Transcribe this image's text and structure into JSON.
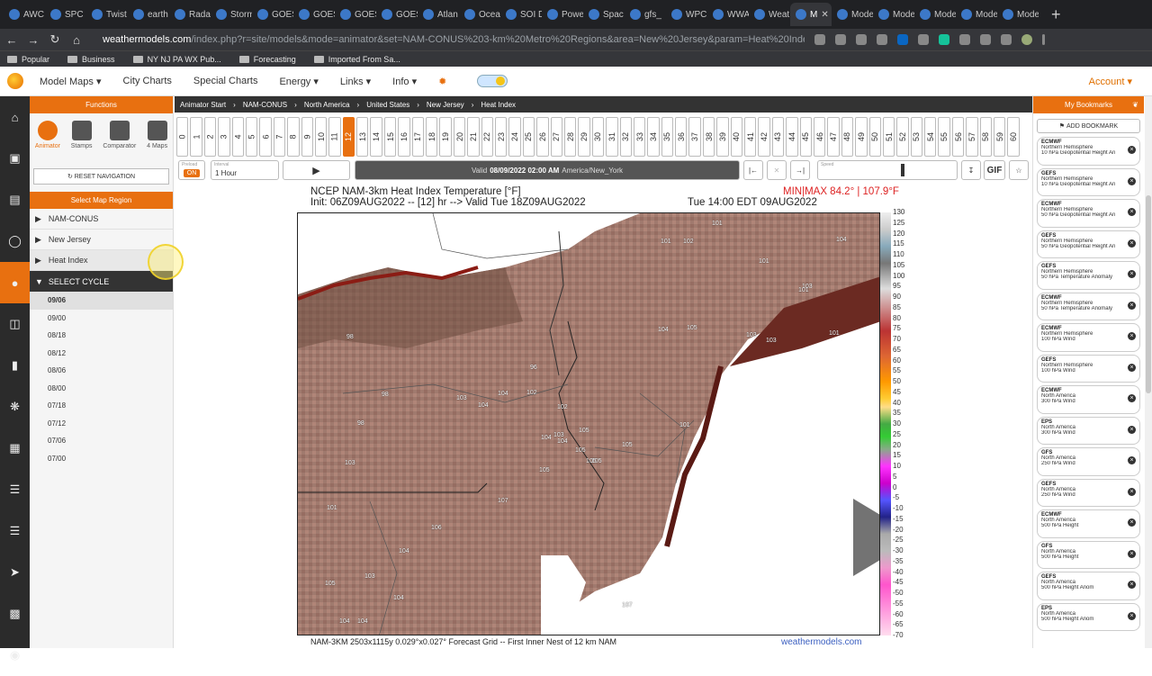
{
  "browser": {
    "tabs": [
      "AWC",
      "SPC",
      "Twist",
      "earth",
      "Rada",
      "Storm",
      "GOES",
      "GOES",
      "GOES",
      "GOES",
      "Atlan",
      "Ocea",
      "SOI D",
      "Powe",
      "Spac",
      "gfs_",
      "WPC",
      "WWA",
      "Weat",
      "M",
      "Mode",
      "Mode",
      "Mode",
      "Mode",
      "Mode"
    ],
    "active_tab_index": 19,
    "url_host": "weathermodels.com",
    "url_path": "/index.php?r=site/models&mode=animator&set=NAM-CONUS%203-km%20Metro%20Regions&area=New%20Jersey&param=Heat%20Index&offset=0",
    "bookmarks": [
      "Popular",
      "Business",
      "NY NJ PA WX Pub...",
      "Forecasting",
      "Imported From Sa..."
    ]
  },
  "site_nav": {
    "items": [
      "Model Maps",
      "City Charts",
      "Special Charts",
      "Energy",
      "Links",
      "Info"
    ],
    "account": "Account"
  },
  "functions": {
    "header": "Functions",
    "buttons": [
      "Animator",
      "Stamps",
      "Comparator",
      "4 Maps"
    ],
    "reset": "RESET NAVIGATION",
    "region_header": "Select Map Region",
    "regions": [
      "NAM-CONUS",
      "New Jersey",
      "Heat Index"
    ],
    "cycle_header": "SELECT CYCLE",
    "cycles": [
      "09/06",
      "09/00",
      "08/18",
      "08/12",
      "08/06",
      "08/00",
      "07/18",
      "07/12",
      "07/06",
      "07/00"
    ]
  },
  "breadcrumb": [
    "Animator Start",
    "NAM-CONUS",
    "North America",
    "United States",
    "New Jersey",
    "Heat Index"
  ],
  "hours": [
    "0",
    "1",
    "2",
    "3",
    "4",
    "5",
    "6",
    "7",
    "8",
    "9",
    "10",
    "11",
    "12",
    "13",
    "14",
    "15",
    "16",
    "17",
    "18",
    "19",
    "20",
    "21",
    "22",
    "23",
    "24",
    "25",
    "26",
    "27",
    "28",
    "29",
    "30",
    "31",
    "32",
    "33",
    "34",
    "35",
    "36",
    "37",
    "38",
    "39",
    "40",
    "41",
    "42",
    "43",
    "44",
    "45",
    "46",
    "47",
    "48",
    "49",
    "50",
    "51",
    "52",
    "53",
    "54",
    "55",
    "56",
    "57",
    "58",
    "59",
    "60"
  ],
  "selected_hour": "12",
  "controls": {
    "preload_label": "Preload",
    "preload_value": "ON",
    "interval_label": "Interval",
    "interval_value": "1 Hour",
    "valid_prefix": "Valid",
    "valid_time": "08/09/2022 02:00 AM",
    "valid_tz": "America/New_York",
    "speed_label": "Speed",
    "gif": "GIF"
  },
  "map": {
    "title1": "NCEP NAM-3km Heat Index Temperature [°F]",
    "title2": "Init: 06Z09AUG2022 -- [12] hr --> Valid Tue 18Z09AUG2022",
    "minmax": "MIN|MAX 84.2° | 107.9°F",
    "local_time": "Tue 14:00 EDT 09AUG2022",
    "footer": "NAM-3KM 2503x1115y 0.029°x0.027° Forecast Grid -- First Inner Nest of 12 km NAM",
    "brand": "weathermodels.com",
    "scale": [
      "130",
      "125",
      "120",
      "115",
      "110",
      "105",
      "100",
      "95",
      "90",
      "85",
      "80",
      "75",
      "70",
      "65",
      "60",
      "55",
      "50",
      "45",
      "40",
      "35",
      "30",
      "25",
      "20",
      "15",
      "10",
      "5",
      "0",
      "-5",
      "-10",
      "-15",
      "-20",
      "-25",
      "-30",
      "-35",
      "-40",
      "-45",
      "-50",
      "-55",
      "-60",
      "-65",
      "-70"
    ],
    "values": [
      "101",
      "101",
      "102",
      "101",
      "104",
      "98",
      "103",
      "96",
      "103",
      "101",
      "98",
      "104",
      "105",
      "102",
      "102",
      "103",
      "98",
      "103",
      "104",
      "103",
      "104",
      "104",
      "105",
      "101",
      "104",
      "105",
      "101",
      "105",
      "105",
      "105",
      "103",
      "107",
      "101",
      "106",
      "107",
      "105",
      "104",
      "103",
      "104",
      "104",
      "105",
      "104"
    ]
  },
  "bookmarks": {
    "header": "My Bookmarks",
    "add": "ADD BOOKMARK",
    "items": [
      {
        "model": "ECMWF",
        "area": "Northern Hemisphere",
        "param": "10 hPa Geopotential Height An"
      },
      {
        "model": "GEFS",
        "area": "Northern Hemisphere",
        "param": "10 hPa Geopotential Height An"
      },
      {
        "model": "ECMWF",
        "area": "Northern Hemisphere",
        "param": "50 hPa Geopotential Height An"
      },
      {
        "model": "GEFS",
        "area": "Northern Hemisphere",
        "param": "50 hPa Geopotential Height An"
      },
      {
        "model": "GEFS",
        "area": "Northern Hemisphere",
        "param": "50 hPa Temperature Anomaly"
      },
      {
        "model": "ECMWF",
        "area": "Northern Hemisphere",
        "param": "50 hPa Temperature Anomaly"
      },
      {
        "model": "ECMWF",
        "area": "Northern Hemisphere",
        "param": "100 hPa Wind"
      },
      {
        "model": "GEFS",
        "area": "Northern Hemisphere",
        "param": "100 hPa Wind"
      },
      {
        "model": "ECMWF",
        "area": "North America",
        "param": "300 hPa Wind"
      },
      {
        "model": "EPS",
        "area": "North America",
        "param": "300 hPa Wind"
      },
      {
        "model": "GFS",
        "area": "North America",
        "param": "250 hPa Wind"
      },
      {
        "model": "GEFS",
        "area": "North America",
        "param": "250 hPa Wind"
      },
      {
        "model": "ECMWF",
        "area": "North America",
        "param": "500 hPa Height"
      },
      {
        "model": "GFS",
        "area": "North America",
        "param": "500 hPa Height"
      },
      {
        "model": "GEFS",
        "area": "North America",
        "param": "500 hPa Height Anom"
      },
      {
        "model": "EPS",
        "area": "North America",
        "param": "500 hPa Height Anom"
      }
    ]
  }
}
